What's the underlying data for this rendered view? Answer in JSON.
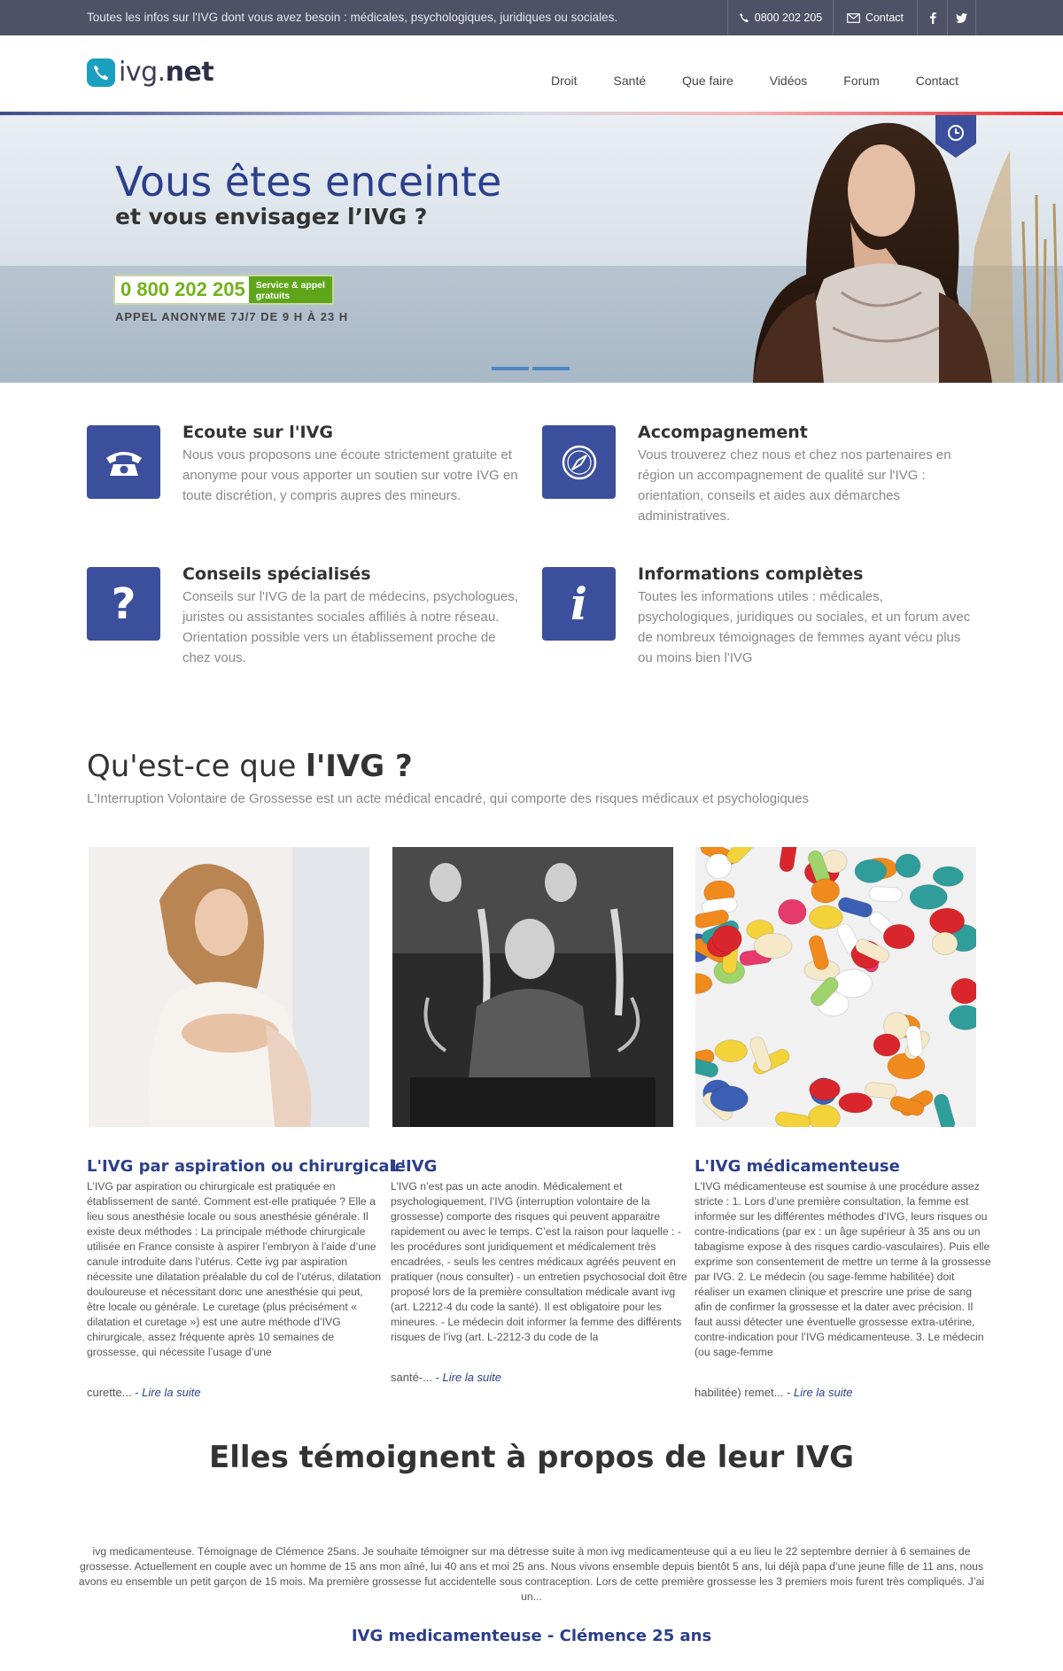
{
  "topbar": {
    "tagline": "Toutes les infos sur l'IVG dont vous avez besoin : médicales, psychologiques, juridiques ou sociales.",
    "phone": "0800 202 205",
    "contact": "Contact",
    "facebook_icon": "facebook-icon",
    "twitter_icon": "twitter-icon"
  },
  "header": {
    "logo_prefix": "ivg.",
    "logo_suffix": "net",
    "nav": [
      "Droit",
      "Santé",
      "Que faire",
      "Vidéos",
      "Forum",
      "Contact"
    ]
  },
  "hero": {
    "title_line1": "Vous êtes enceinte",
    "title_line2": "et vous envisagez l’IVG ?",
    "phone_number": "0 800 202 205",
    "phone_badge_line1": "Service & appel",
    "phone_badge_line2": "gratuits",
    "subtitle": "APPEL ANONYME 7J/7 DE 9 H À 23 H",
    "slides": 2,
    "active_slide": 1
  },
  "features": [
    {
      "title": "Ecoute sur l'IVG",
      "text": "Nous vous proposons une écoute strictement gratuite et anonyme pour vous apporter un soutien sur votre IVG en toute discrétion, y compris aupres des mineurs.",
      "icon": "telephone-icon"
    },
    {
      "title": "Accompagnement",
      "text": "Vous trouverez chez nous et chez nos partenaires en région un accompagnement de qualité sur l'IVG : orientation, conseils et aides aux démarches administratives.",
      "icon": "compass-icon"
    },
    {
      "title": "Conseils spécialisés",
      "text": "Conseils sur l'IVG de la part de médecins, psychologues, juristes ou assistantes sociales affiliés à notre réseau. Orientation possible vers un établissement proche de chez vous.",
      "icon": "question-icon"
    },
    {
      "title": "Informations complètes",
      "text": "Toutes les informations utiles : médicales, psychologiques, juridiques ou sociales, et un forum avec de nombreux témoignages de femmes ayant vécu plus ou moins bien l'IVG",
      "icon": "info-icon"
    }
  ],
  "section": {
    "title_normal": "Qu'est-ce que ",
    "title_bold": "l'IVG ?",
    "subtitle": "L'Interruption Volontaire de Grossesse est un acte médical encadré, qui comporte des risques médicaux et psychologiques"
  },
  "articles": [
    {
      "title": "L'IVG par aspiration ou chirurgicale",
      "text": "L’IVG par aspiration ou chirurgicale est pratiquée en établissement de santé. Comment est-elle pratiquée ? Elle a lieu sous anesthésie locale ou sous anesthésie générale. Il existe deux méthodes : La principale méthode chirurgicale utilisée en France consiste à aspirer l’embryon à l’aide d’une canule introduite dans l’utérus. Cette ivg par aspiration nécessite une dilatation préalable du col de l’utérus, dilatation douloureuse et nécessitant donc une anesthésie qui peut, être locale ou générale. Le curetage (plus précisément « dilatation et curetage ») est une autre méthode d’IVG chirurgicale, assez fréquente après 10 semaines de grossesse, qui nécessite l’usage d’une",
      "more_prefix": "curette... - ",
      "more_link": "Lire la suite"
    },
    {
      "title": "L'IVG",
      "text": "L’IVG n’est pas un acte anodin. Médicalement et psychologiquement, l’IVG (interruption volontaire de la grossesse) comporte des risques qui peuvent apparaitre rapidement ou avec le temps. C’est la raison pour laquelle : - les procédures sont juridiquement et médicalement très encadrées, - seuls les centres médicaux agréés peuvent en pratiquer (nous consulter) - un entretien psychosocial doit être proposé lors de la première consultation médicale  avant ivg (art. L2212-4 du code la santé). Il est obligatoire pour les mineures. - Le médecin  doit  informer la femme des différents risques de l’ivg (art. L-2212-3 du code de la",
      "more_prefix": "santé-... - ",
      "more_link": "Lire la suite"
    },
    {
      "title": "L'IVG médicamenteuse",
      "text": "L’IVG médicamenteuse est soumise à une procédure assez stricte : 1. Lors d’une première consultation, la femme est informée sur les différentes méthodes d’IVG, leurs risques ou contre-indications (par ex : un âge supérieur à 35 ans ou un tabagisme expose à des risques cardio-vasculaires). Puis elle exprime son consentement de mettre un terme à la grossesse par IVG. 2. Le médecin (ou sage-femme habilitée) doit réaliser un examen clinique et prescrire une prise de sang afin de confirmer la grossesse et la dater avec précision. Il faut aussi détecter une éventuelle grossesse extra-utérine, contre-indication pour l’IVG médicamenteuse. 3. Le médecin (ou sage-femme",
      "more_prefix": "habilitée) remet... - ",
      "more_link": "Lire la suite"
    }
  ],
  "testimonials": {
    "title_normal": "Elles témoignent ",
    "title_bold": "à propos de leur IVG",
    "text": "ivg medicamenteuse.   Témoignage de Clémence 25ans. Je souhaite  témoigner sur ma détresse suite à mon ivg medicamenteuse qui a eu lieu le 22 septembre dernier à 6 semaines de grossesse. Actuellement en couple avec un homme de 15 ans mon aîné, lui 40 ans et moi 25 ans. Nous vivons ensemble depuis bientôt 5 ans, lui déjà papa d’une jeune fille de 11 ans, nous avons eu ensemble un petit garçon de 15 mois. Ma première grossesse fut accidentelle sous contraception. Lors de cette première grossesse les 3 premiers mois furent très compliqués. J’ai un...",
    "name": "IVG medicamenteuse - Clémence 25 ans"
  },
  "colors": {
    "primary": "#2c3f8c",
    "topbar": "#4f5267",
    "accent_green": "#73b21b",
    "accent_red": "#e8262c"
  }
}
